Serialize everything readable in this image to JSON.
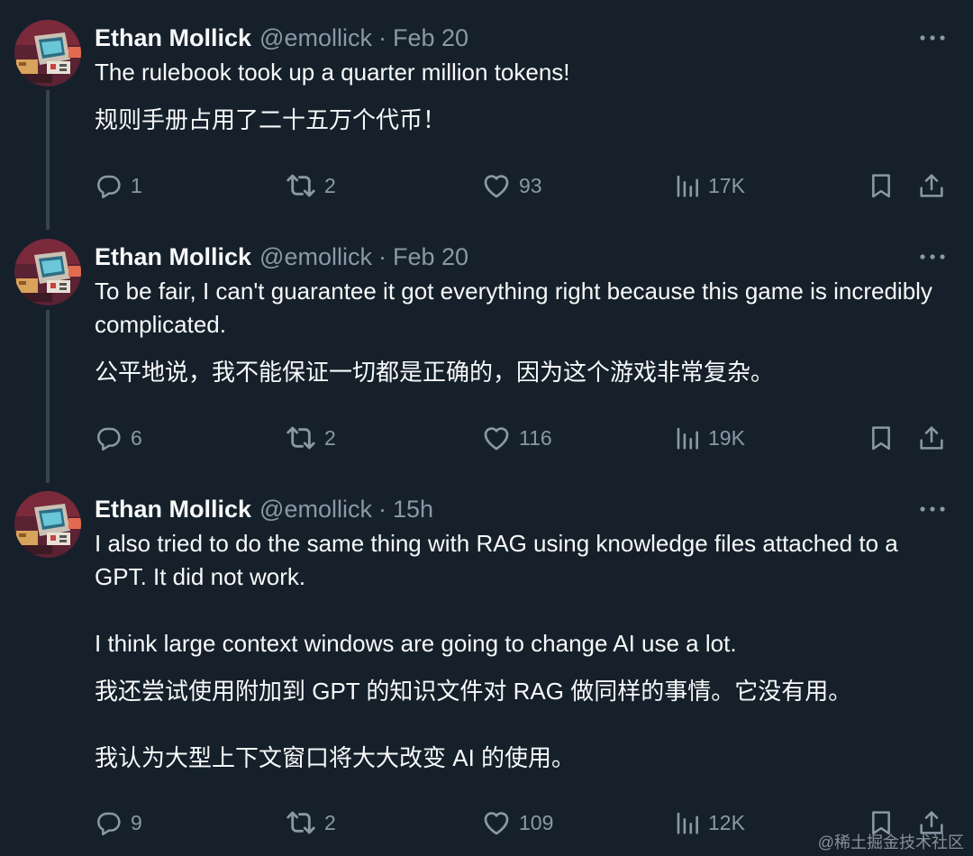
{
  "tweets": [
    {
      "author": "Ethan Mollick",
      "handle": "@emollick",
      "separator": "·",
      "time": "Feb 20",
      "text": [
        "The rulebook took up a quarter million tokens!",
        "规则手册占用了二十五万个代币！"
      ],
      "stats": {
        "replies": "1",
        "reposts": "2",
        "likes": "93",
        "views": "17K"
      }
    },
    {
      "author": "Ethan Mollick",
      "handle": "@emollick",
      "separator": "·",
      "time": "Feb 20",
      "text": [
        "To be fair, I can't guarantee it got everything right because this game is incredibly complicated.",
        "公平地说，我不能保证一切都是正确的，因为这个游戏非常复杂。"
      ],
      "stats": {
        "replies": "6",
        "reposts": "2",
        "likes": "116",
        "views": "19K"
      }
    },
    {
      "author": "Ethan Mollick",
      "handle": "@emollick",
      "separator": "·",
      "time": "15h",
      "text": [
        "I also tried to do the same thing with RAG using knowledge files attached to a GPT. It did not work.",
        "I think large context windows are going to change AI use a lot.",
        "我还尝试使用附加到 GPT 的知识文件对 RAG 做同样的事情。它没有用。",
        "我认为大型上下文窗口将大大改变 AI 的使用。"
      ],
      "stats": {
        "replies": "9",
        "reposts": "2",
        "likes": "109",
        "views": "12K"
      }
    }
  ],
  "watermark": "@稀土掘金技术社区",
  "icons": {
    "reply": "speech-bubble-icon",
    "repost": "repost-arrows-icon",
    "like": "heart-outline-icon",
    "views": "bar-chart-icon",
    "bookmark": "bookmark-icon",
    "share": "share-upload-icon",
    "more": "three-dots-icon"
  },
  "colors": {
    "background": "#15202b",
    "primary_text": "#f7f9f9",
    "secondary_text": "#8b98a5",
    "thread_line": "#38444d"
  }
}
